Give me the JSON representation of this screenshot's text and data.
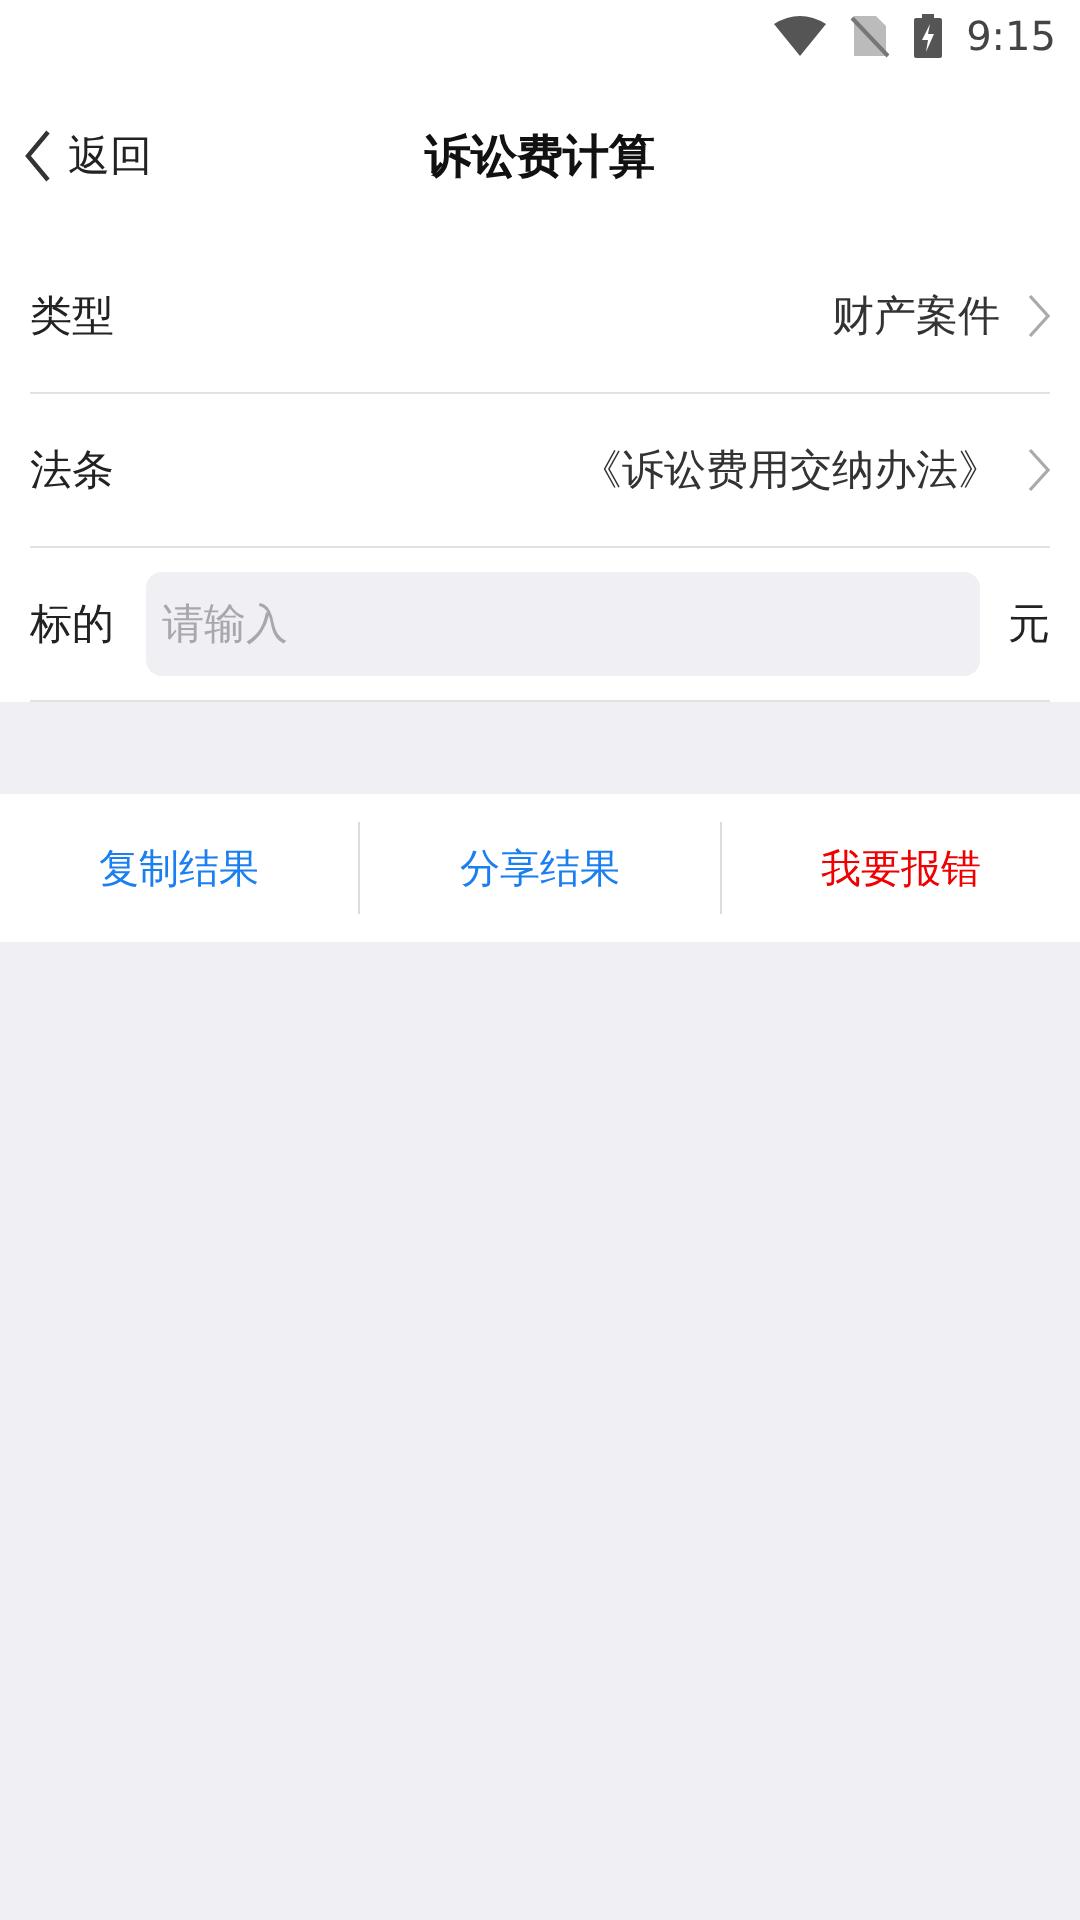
{
  "status_bar": {
    "time": "9:15"
  },
  "nav": {
    "back": "返回",
    "title": "诉讼费计算"
  },
  "rows": [
    {
      "kind": "select",
      "label": "类型",
      "value": "财产案件"
    },
    {
      "kind": "select",
      "label": "法条",
      "value": "《诉讼费用交纳办法》"
    },
    {
      "kind": "input",
      "label": "标的",
      "placeholder": "请输入",
      "unit": "元"
    }
  ],
  "actions": [
    {
      "label": "复制结果",
      "color": "#1a7ff0"
    },
    {
      "label": "分享结果",
      "color": "#1a7ff0"
    },
    {
      "label": "我要报错",
      "color": "#f00000"
    }
  ]
}
